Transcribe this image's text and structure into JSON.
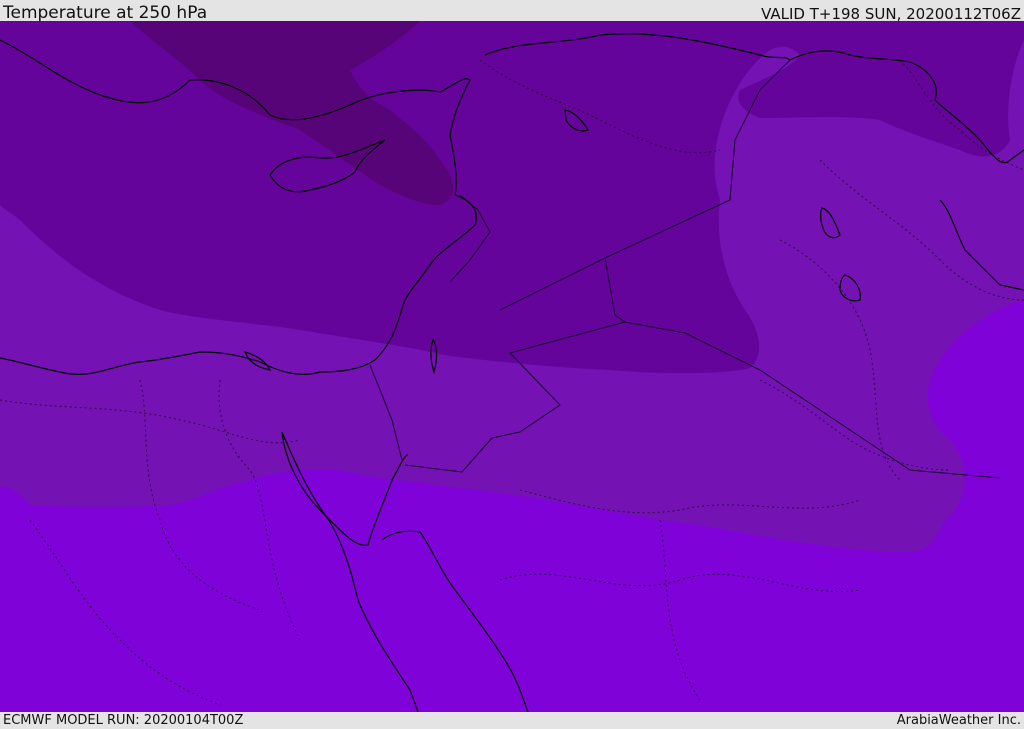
{
  "header": {
    "title": "Temperature at 250 hPa",
    "valid": "VALID T+198 SUN, 20200112T06Z"
  },
  "footer": {
    "model_run": "ECMWF MODEL RUN: 20200104T00Z",
    "credit": "ArabiaWeather Inc."
  },
  "map": {
    "colors": {
      "darkest_band": "#560478",
      "dark_band": "#64049a",
      "mid_band": "#7412b3",
      "light_band": "#7f03d8",
      "coastline": "#000000",
      "border": "#1a0030"
    }
  }
}
